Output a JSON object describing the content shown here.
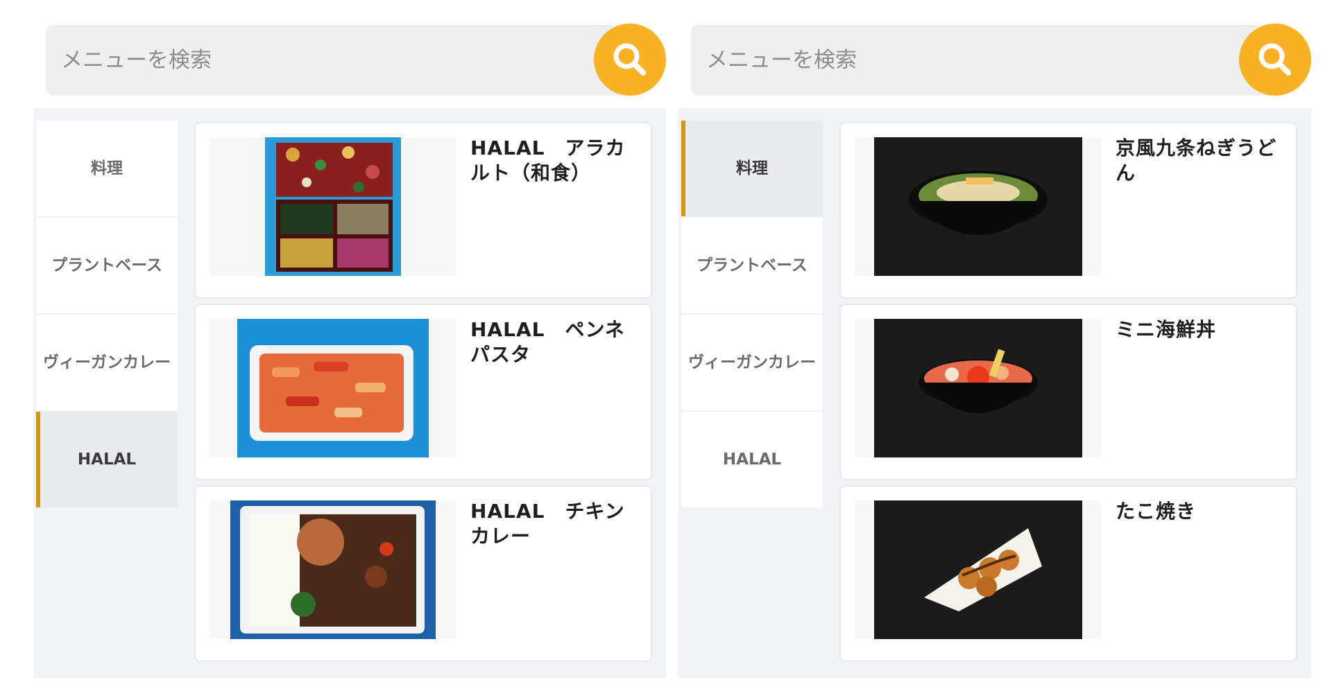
{
  "colors": {
    "accent": "#fab224",
    "active_bar": "#d39712",
    "background": "#f1f3f6"
  },
  "left": {
    "search": {
      "placeholder": "メニューを検索",
      "icon": "search-icon"
    },
    "categories": [
      {
        "label": "料理",
        "active": false
      },
      {
        "label": "プラントベース",
        "active": false
      },
      {
        "label": "ヴィーガンカレー",
        "active": false
      },
      {
        "label": "HALAL",
        "active": true
      }
    ],
    "items": [
      {
        "name": "HALAL　アラカルト（和食）",
        "image": "bento-box-image"
      },
      {
        "name": "HALAL　ペンネパスタ",
        "image": "penne-pasta-image"
      },
      {
        "name": "HALAL　チキンカレー",
        "image": "chicken-curry-image"
      }
    ]
  },
  "right": {
    "search": {
      "placeholder": "メニューを検索",
      "icon": "search-icon"
    },
    "categories": [
      {
        "label": "料理",
        "active": true
      },
      {
        "label": "プラントベース",
        "active": false
      },
      {
        "label": "ヴィーガンカレー",
        "active": false
      },
      {
        "label": "HALAL",
        "active": false
      }
    ],
    "items": [
      {
        "name": "京風九条ねぎうどん",
        "image": "udon-image"
      },
      {
        "name": "ミニ海鮮丼",
        "image": "kaisendon-image"
      },
      {
        "name": "たこ焼き",
        "image": "takoyaki-image"
      }
    ]
  }
}
